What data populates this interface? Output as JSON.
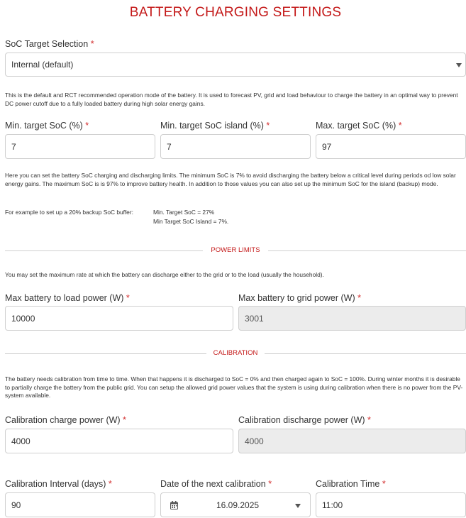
{
  "page": {
    "title": "BATTERY CHARGING SETTINGS"
  },
  "soc_target": {
    "label": "SoC Target Selection",
    "required": "*",
    "value": "Internal (default)",
    "description": "This is the default and RCT recommended operation mode of the battery. It is used to forecast PV, grid and load behaviour to charge the battery in an optimal way to prevent DC power cutoff due to a fully loaded battery during high solar energy gains."
  },
  "limits": {
    "min_target": {
      "label": "Min. target SoC (%)",
      "required": "*",
      "value": "7"
    },
    "min_island": {
      "label": "Min. target SoC island (%)",
      "required": "*",
      "value": "7"
    },
    "max_target": {
      "label": "Max. target SoC (%)",
      "required": "*",
      "value": "97"
    },
    "description": "Here you can set the battery SoC charging and discharging limits. The minimum SoC is 7% to avoid discharging the battery below a critical level during periods od low solar energy gains. The maximum SoC is is 97% to improve battery health. In addition to those values you can also set up the minimum SoC for the island (backup) mode.",
    "example_intro": "For example to set up a 20% backup SoC buffer:",
    "example_line1": "Min. Target SoC = 27%",
    "example_line2": "Min Target SoC Island = 7%."
  },
  "power_limits": {
    "section_title": "POWER LIMITS",
    "description": "You may set the maximum rate at which the battery can discharge either to the grid or to the load (usually the household).",
    "to_load": {
      "label": "Max battery to load power (W)",
      "required": "*",
      "value": "10000"
    },
    "to_grid": {
      "label": "Max battery to grid power (W)",
      "required": "*",
      "value": "3001"
    }
  },
  "calibration": {
    "section_title": "CALIBRATION",
    "description": "The battery needs calibration from time to time. When that happens it is discharged to SoC = 0% and then charged again to SoC = 100%. During winter months it is desirable to partially charge the battery from the public grid. You can setup the allowed grid power values that the system is using during calibration when there is no power from the PV-system available.",
    "charge_power": {
      "label": "Calibration charge power (W)",
      "required": "*",
      "value": "4000"
    },
    "discharge_power": {
      "label": "Calibration discharge power (W)",
      "required": "*",
      "value": "4000"
    },
    "interval": {
      "label": "Calibration Interval (days)",
      "required": "*",
      "value": "90"
    },
    "next_date": {
      "label": "Date of the next calibration",
      "required": "*",
      "value": "16.09.2025"
    },
    "time": {
      "label": "Calibration Time",
      "required": "*",
      "value": "11:00"
    }
  },
  "colors": {
    "accent": "#c41919",
    "required": "#d32f2f",
    "border": "#cfcfcf",
    "disabled_bg": "#ececec"
  },
  "icons": {
    "select_arrow": "chevron-down-icon",
    "calendar": "calendar-icon"
  }
}
